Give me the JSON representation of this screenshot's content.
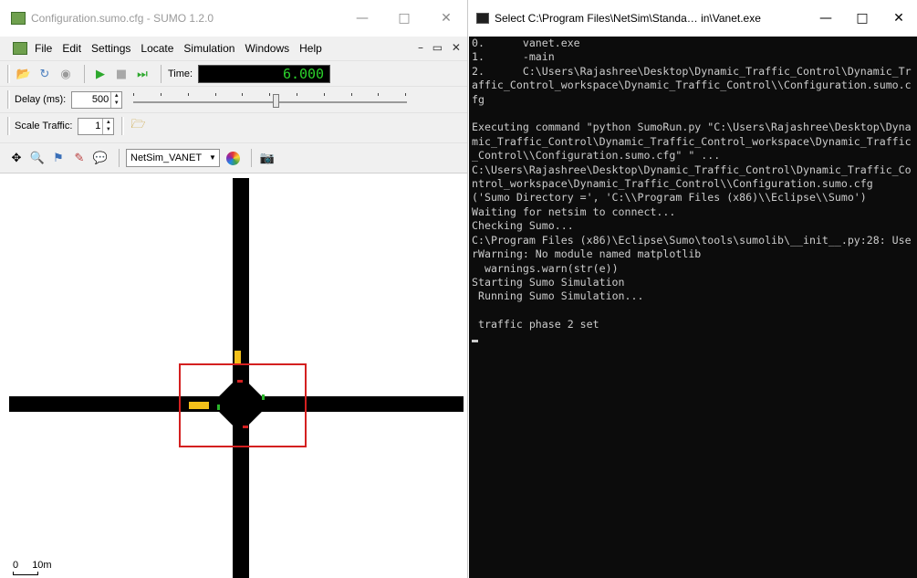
{
  "sumo": {
    "window_title": "Configuration.sumo.cfg - SUMO 1.2.0",
    "menu": [
      "File",
      "Edit",
      "Settings",
      "Locate",
      "Simulation",
      "Windows",
      "Help"
    ],
    "time_label": "Time:",
    "time_value": "6.000",
    "delay_label": "Delay (ms):",
    "delay_value": "500",
    "scale_label": "Scale Traffic:",
    "scale_value": "1",
    "view_scheme": "NetSim_VANET",
    "scale_bar_start": "0",
    "scale_bar_end": "10m",
    "delay_slider_level": 0.52
  },
  "console": {
    "window_title": "Select C:\\Program Files\\NetSim\\Standa… in\\Vanet.exe",
    "lines": [
      "0.      vanet.exe",
      "1.      -main",
      "2.      C:\\Users\\Rajashree\\Desktop\\Dynamic_Traffic_Control\\Dynamic_Traffic_Control_workspace\\Dynamic_Traffic_Control\\\\Configuration.sumo.cfg",
      "",
      "Executing command \"python SumoRun.py \"C:\\Users\\Rajashree\\Desktop\\Dynamic_Traffic_Control\\Dynamic_Traffic_Control_workspace\\Dynamic_Traffic_Control\\\\Configuration.sumo.cfg\" \" ...",
      "C:\\Users\\Rajashree\\Desktop\\Dynamic_Traffic_Control\\Dynamic_Traffic_Control_workspace\\Dynamic_Traffic_Control\\\\Configuration.sumo.cfg",
      "('Sumo Directory =', 'C:\\\\Program Files (x86)\\\\Eclipse\\\\Sumo')",
      "Waiting for netsim to connect...",
      "Checking Sumo...",
      "C:\\Program Files (x86)\\Eclipse\\Sumo\\tools\\sumolib\\__init__.py:28: UserWarning: No module named matplotlib",
      "  warnings.warn(str(e))",
      "Starting Sumo Simulation",
      " Running Sumo Simulation...",
      "",
      " traffic phase 2 set"
    ]
  }
}
